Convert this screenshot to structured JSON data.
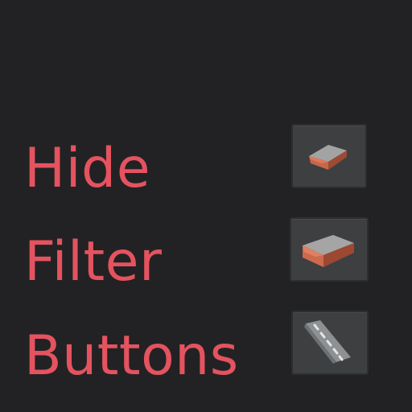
{
  "title": {
    "lines": [
      "Hide",
      "Filter",
      "Buttons"
    ],
    "color": "#e4535f"
  },
  "colors": {
    "background": "#222224",
    "button_bg": "#3d3f41",
    "button_border": "#2c2e30",
    "roof": "#9b9b9b",
    "brick": "#d06a4c",
    "road": "#8a8d8f"
  },
  "buttons": [
    {
      "icon": "small-building-icon"
    },
    {
      "icon": "large-building-icon"
    },
    {
      "icon": "road-icon"
    }
  ]
}
